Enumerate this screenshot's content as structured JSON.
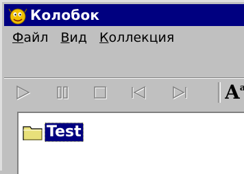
{
  "window": {
    "title": "Колобок",
    "icon": "kolobok-app-icon"
  },
  "menu": {
    "items": [
      {
        "accel": "Ф",
        "rest": "айл"
      },
      {
        "accel": "В",
        "rest": "ид"
      },
      {
        "accel": "К",
        "rest": "оллекция"
      }
    ]
  },
  "toolbar": {
    "buttons": [
      "play-icon",
      "pause-icon",
      "stop-icon",
      "skip-back-icon",
      "skip-forward-icon"
    ],
    "font_button": {
      "glyph": "A",
      "sup": "a"
    },
    "disabled_color": "#808080",
    "disabled_highlight": "#ffffff"
  },
  "tree": {
    "items": [
      {
        "label": "Test",
        "icon": "folder-icon",
        "selected": true
      }
    ]
  },
  "colors": {
    "titlebar": "#000080",
    "selection": "#000080",
    "face": "#c0c0c0",
    "folder": "#e8e07a"
  }
}
